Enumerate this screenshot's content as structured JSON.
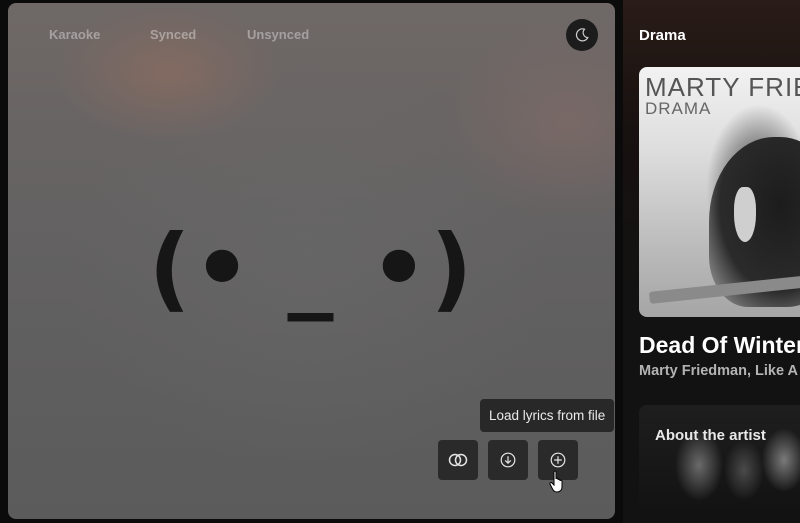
{
  "lyrics": {
    "modes": [
      {
        "label": "Karaoke"
      },
      {
        "label": "Synced"
      },
      {
        "label": "Unsynced"
      }
    ],
    "theme_icon": "moon-icon",
    "empty_state_glyph": "(• _ •)",
    "tools": [
      {
        "icon": "dual-circles-icon"
      },
      {
        "icon": "download-circle-icon"
      },
      {
        "icon": "plus-circle-icon"
      }
    ],
    "tooltip": "Load lyrics from file"
  },
  "sidebar": {
    "title": "Drama",
    "cover": {
      "artist_text": "MARTY FRIE",
      "album_text": "DRAMA"
    },
    "track_title": "Dead Of Winter",
    "track_artists": "Marty Friedman, Like A",
    "about_label": "About the artist"
  },
  "colors": {
    "panel_bg": "#646262",
    "button_bg": "#2a2a2a",
    "tooltip_bg": "#282828",
    "sidebar_bg": "#121212"
  }
}
